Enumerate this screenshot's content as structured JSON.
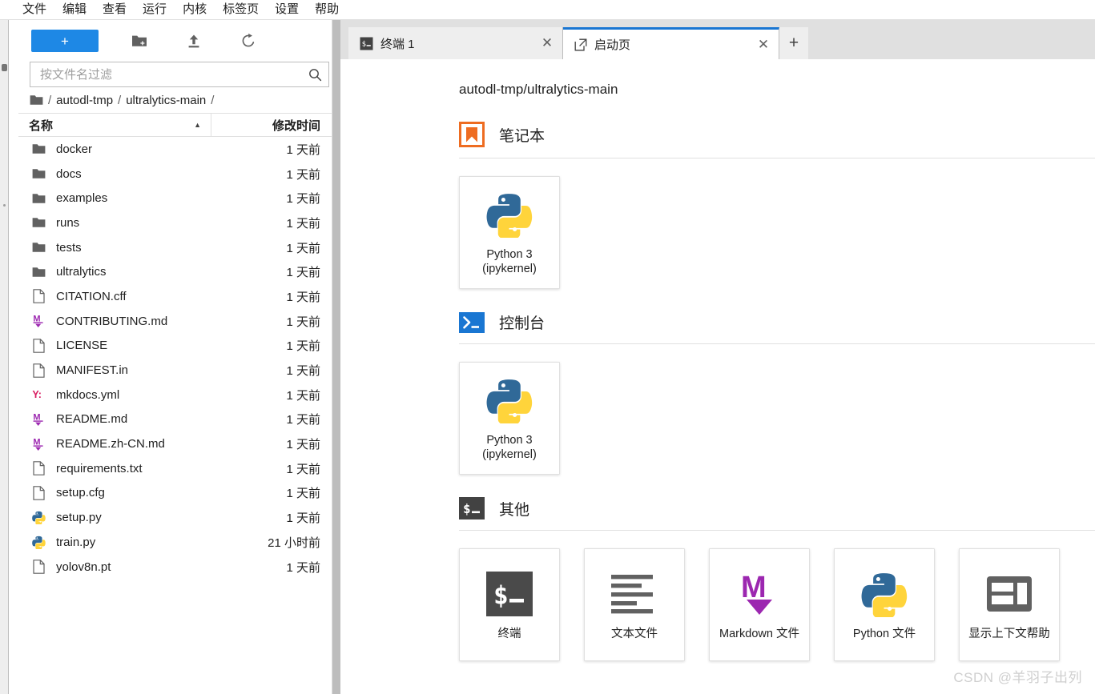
{
  "menubar": {
    "items": [
      {
        "label": "文件"
      },
      {
        "label": "编辑"
      },
      {
        "label": "查看"
      },
      {
        "label": "运行"
      },
      {
        "label": "内核"
      },
      {
        "label": "标签页"
      },
      {
        "label": "设置"
      },
      {
        "label": "帮助"
      }
    ]
  },
  "filebrowser": {
    "toolbar": {
      "new_launcher_label": "+",
      "new_folder_icon": "new-folder-icon",
      "upload_icon": "upload-icon",
      "refresh_icon": "refresh-icon"
    },
    "filter": {
      "value": "",
      "placeholder": "按文件名过滤",
      "icon": "search-icon"
    },
    "breadcrumb": {
      "root_icon": "folder-icon",
      "parts": [
        "autodl-tmp",
        "ultralytics-main"
      ],
      "separator": "/"
    },
    "columns": {
      "name": "名称",
      "modified": "修改时间",
      "sort_caret": "▲"
    },
    "rows": [
      {
        "name": "docker",
        "modified": "1 天前",
        "icon": "folder-icon",
        "kind": "folder"
      },
      {
        "name": "docs",
        "modified": "1 天前",
        "icon": "folder-icon",
        "kind": "folder"
      },
      {
        "name": "examples",
        "modified": "1 天前",
        "icon": "folder-icon",
        "kind": "folder"
      },
      {
        "name": "runs",
        "modified": "1 天前",
        "icon": "folder-icon",
        "kind": "folder"
      },
      {
        "name": "tests",
        "modified": "1 天前",
        "icon": "folder-icon",
        "kind": "folder"
      },
      {
        "name": "ultralytics",
        "modified": "1 天前",
        "icon": "folder-icon",
        "kind": "folder"
      },
      {
        "name": "CITATION.cff",
        "modified": "1 天前",
        "icon": "file-icon",
        "kind": "file"
      },
      {
        "name": "CONTRIBUTING.md",
        "modified": "1 天前",
        "icon": "markdown-icon",
        "kind": "markdown"
      },
      {
        "name": "LICENSE",
        "modified": "1 天前",
        "icon": "file-icon",
        "kind": "file"
      },
      {
        "name": "MANIFEST.in",
        "modified": "1 天前",
        "icon": "file-icon",
        "kind": "file"
      },
      {
        "name": "mkdocs.yml",
        "modified": "1 天前",
        "icon": "yaml-icon",
        "kind": "yaml"
      },
      {
        "name": "README.md",
        "modified": "1 天前",
        "icon": "markdown-icon",
        "kind": "markdown"
      },
      {
        "name": "README.zh-CN.md",
        "modified": "1 天前",
        "icon": "markdown-icon",
        "kind": "markdown"
      },
      {
        "name": "requirements.txt",
        "modified": "1 天前",
        "icon": "file-icon",
        "kind": "file"
      },
      {
        "name": "setup.cfg",
        "modified": "1 天前",
        "icon": "file-icon",
        "kind": "file"
      },
      {
        "name": "setup.py",
        "modified": "1 天前",
        "icon": "python-icon",
        "kind": "python"
      },
      {
        "name": "train.py",
        "modified": "21 小时前",
        "icon": "python-icon",
        "kind": "python"
      },
      {
        "name": "yolov8n.pt",
        "modified": "1 天前",
        "icon": "file-icon",
        "kind": "file"
      }
    ]
  },
  "tabbar": {
    "tabs": [
      {
        "label": "终端 1",
        "icon": "terminal-icon",
        "active": false,
        "close": "✕"
      },
      {
        "label": "启动页",
        "icon": "launcher-icon",
        "active": true,
        "close": "✕"
      }
    ],
    "add_tab_label": "+"
  },
  "launcher": {
    "cwd": "autodl-tmp/ultralytics-main",
    "sections": [
      {
        "title": "笔记本",
        "icon": "notebook-icon",
        "cards": [
          {
            "label": "Python 3",
            "sublabel": "(ipykernel)",
            "icon": "python-logo-icon"
          }
        ]
      },
      {
        "title": "控制台",
        "icon": "console-icon",
        "cards": [
          {
            "label": "Python 3",
            "sublabel": "(ipykernel)",
            "icon": "python-logo-icon"
          }
        ]
      },
      {
        "title": "其他",
        "icon": "terminal-icon",
        "cards": [
          {
            "label": "终端",
            "sublabel": "",
            "icon": "terminal-big-icon"
          },
          {
            "label": "文本文件",
            "sublabel": "",
            "icon": "text-file-icon"
          },
          {
            "label": "Markdown 文件",
            "sublabel": "",
            "icon": "markdown-big-icon"
          },
          {
            "label": "Python 文件",
            "sublabel": "",
            "icon": "python-logo-icon"
          },
          {
            "label": "显示上下文帮助",
            "sublabel": "",
            "icon": "context-help-icon"
          }
        ]
      }
    ]
  },
  "watermark": "CSDN @羊羽子出列",
  "colors": {
    "accent_blue": "#1e88e5",
    "tab_active_border": "#1976d2",
    "notebook_orange": "#ee6c21",
    "markdown_purple": "#9c27b0",
    "yaml_pink": "#d81b60",
    "terminal_dark": "#424242",
    "python_blue": "#306998",
    "python_yellow": "#ffd43b"
  }
}
